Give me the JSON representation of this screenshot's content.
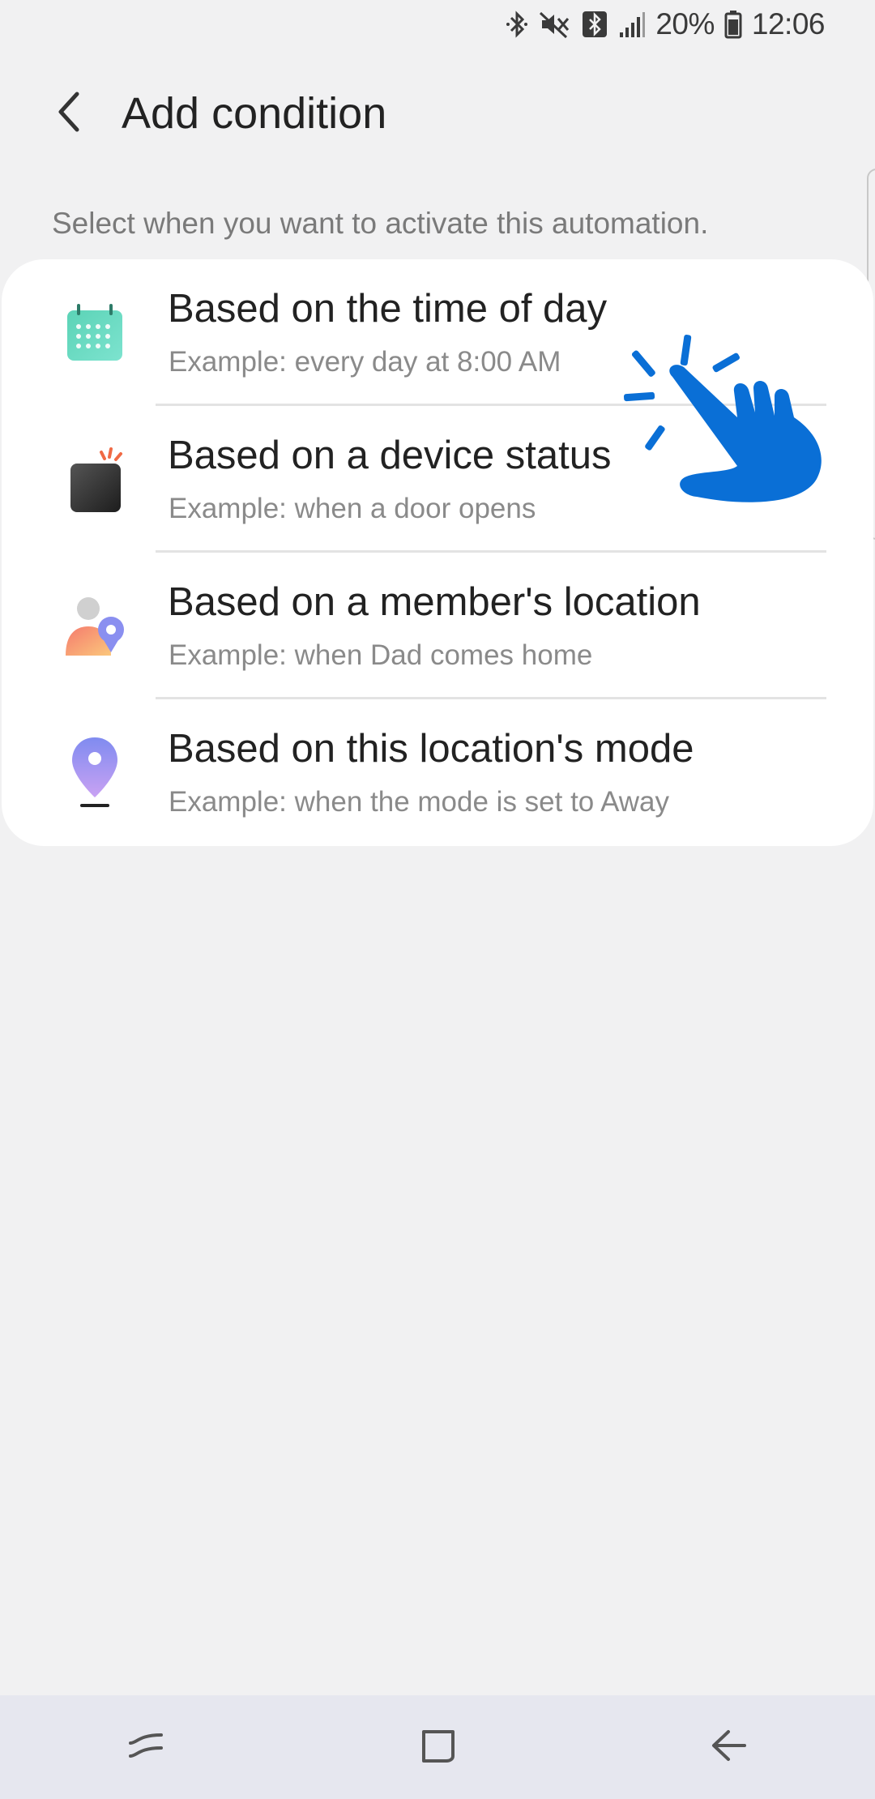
{
  "status_bar": {
    "battery_text": "20%",
    "time": "12:06",
    "icons": [
      "bluetooth-icon",
      "mute-icon",
      "bluetooth-box-icon",
      "signal-icon",
      "battery-icon"
    ]
  },
  "app_bar": {
    "title": "Add condition",
    "back_icon": "back-arrow-icon"
  },
  "description": "Select when you want to activate this automation.",
  "conditions": [
    {
      "title": "Based on the time of day",
      "subtitle": "Example: every day at 8:00 AM",
      "icon": "calendar-icon"
    },
    {
      "title": "Based on a device status",
      "subtitle": "Example: when a door opens",
      "icon": "device-status-icon"
    },
    {
      "title": "Based on a member's location",
      "subtitle": "Example: when Dad comes home",
      "icon": "member-location-icon"
    },
    {
      "title": "Based on this location's mode",
      "subtitle": "Example: when the mode is set to Away",
      "icon": "location-mode-icon"
    }
  ],
  "overlay": {
    "icon": "tap-hand-icon",
    "color": "#0a6fd6"
  },
  "nav_bar": {
    "buttons": [
      "recents-icon",
      "home-icon",
      "back-icon"
    ]
  },
  "colors": {
    "background": "#f1f1f2",
    "card": "#ffffff",
    "nav_bar": "#e6e7ef",
    "hand_blue": "#0a6fd6"
  }
}
